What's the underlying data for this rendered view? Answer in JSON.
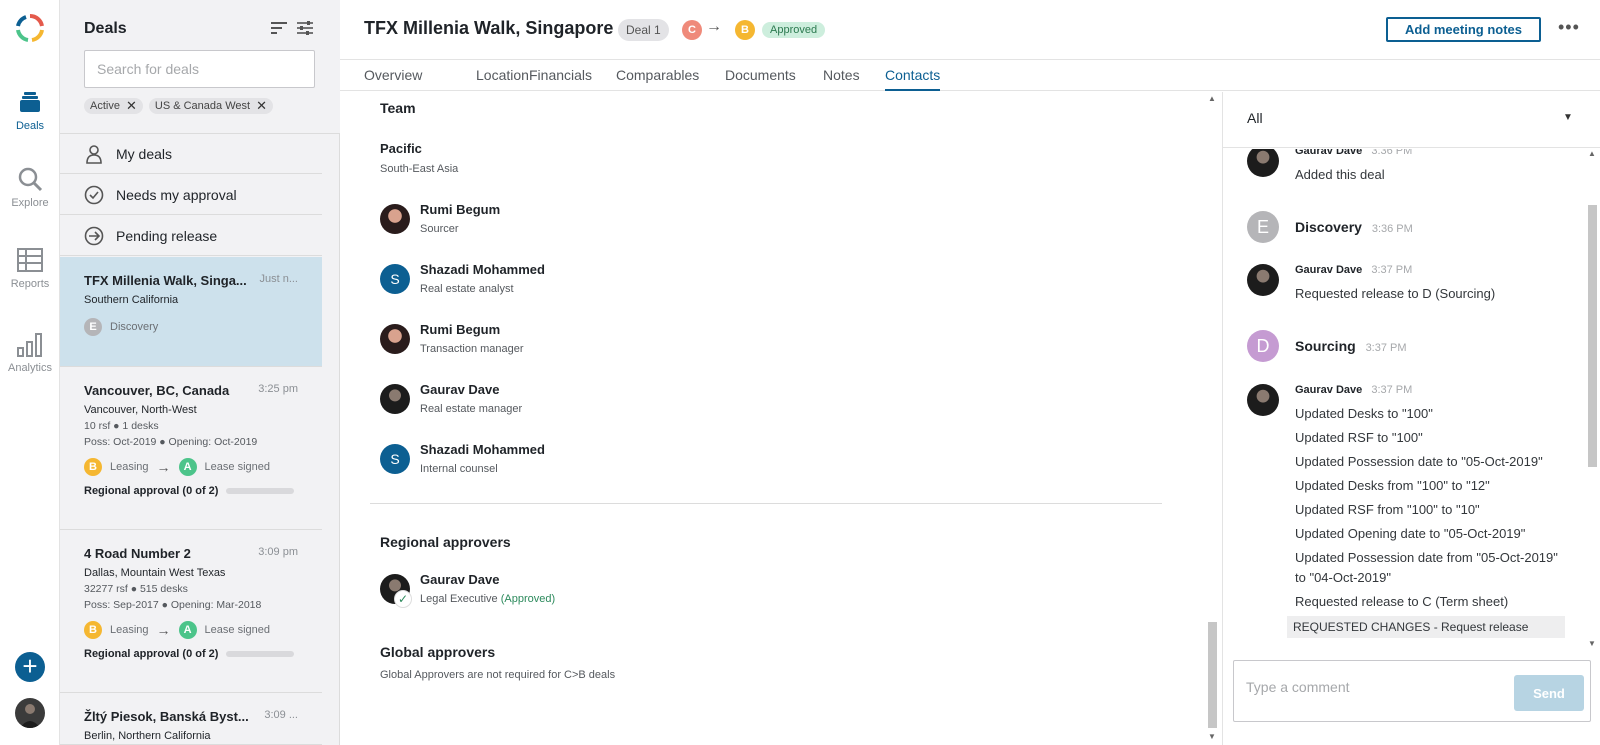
{
  "nav": {
    "deals_label": "Deals",
    "explore_label": "Explore",
    "reports_label": "Reports",
    "analytics_label": "Analytics",
    "add_glyph": "+"
  },
  "deals_panel": {
    "title": "Deals",
    "search_placeholder": "Search for deals",
    "filters": [
      "Active",
      "US & Canada West"
    ],
    "quick_filters": [
      "My deals",
      "Needs my approval",
      "Pending release"
    ],
    "cards": [
      {
        "title": "TFX Millenia Walk, Singa...",
        "time": "Just n...",
        "location": "Southern California",
        "stage_letter": "E",
        "stage": "Discovery"
      },
      {
        "title": "Vancouver, BC, Canada",
        "time": "3:25 pm",
        "location": "Vancouver, North-West",
        "size": "10 rsf ● 1 desks",
        "dates": "Poss: Oct-2019 ● Opening: Oct-2019",
        "from_letter": "B",
        "from_stage": "Leasing",
        "to_letter": "A",
        "to_stage": "Lease signed",
        "approval": "Regional approval (0 of 2)"
      },
      {
        "title": "4 Road Number 2",
        "time": "3:09 pm",
        "location": "Dallas, Mountain West Texas",
        "size": "32277 rsf ● 515 desks",
        "dates": "Poss: Sep-2017 ● Opening: Mar-2018",
        "from_letter": "B",
        "from_stage": "Leasing",
        "to_letter": "A",
        "to_stage": "Lease signed",
        "approval": "Regional approval (0 of 2)"
      },
      {
        "title": "Žltý Piesok, Banská Byst...",
        "time": "3:09 ...",
        "location": "Berlin, Northern California"
      }
    ]
  },
  "header": {
    "title": "TFX Millenia Walk, Singapore",
    "deal_pill": "Deal 1",
    "from_stage_letter": "C",
    "to_stage_letter": "B",
    "status": "Approved",
    "meeting_button": "Add meeting notes",
    "more": "•••"
  },
  "tabs": [
    "Overview",
    "Location",
    "Financials",
    "Comparables",
    "Documents",
    "Notes",
    "Contacts"
  ],
  "contacts": {
    "team_heading": "Team",
    "group_name": "Pacific",
    "group_region": "South-East Asia",
    "people": [
      {
        "name": "Rumi Begum",
        "role": "Sourcer",
        "initial": ""
      },
      {
        "name": "Shazadi Mohammed",
        "role": "Real estate analyst",
        "initial": "S"
      },
      {
        "name": "Rumi Begum",
        "role": "Transaction manager",
        "initial": ""
      },
      {
        "name": "Gaurav Dave",
        "role": "Real estate manager",
        "initial": ""
      },
      {
        "name": "Shazadi Mohammed",
        "role": "Internal counsel",
        "initial": "S"
      }
    ],
    "regional_heading": "Regional approvers",
    "regional_name": "Gaurav Dave",
    "regional_role": "Legal Executive",
    "regional_status": "(Approved)",
    "global_heading": "Global approvers",
    "global_note": "Global Approvers are not required for C>B deals"
  },
  "activity": {
    "filter_value": "All",
    "entries": [
      {
        "kind": "user",
        "who": "Gaurav Dave",
        "time": "3:36 PM",
        "lines": [
          "Added this deal"
        ]
      },
      {
        "kind": "stage",
        "letter": "E",
        "name": "Discovery",
        "time": "3:36 PM"
      },
      {
        "kind": "user",
        "who": "Gaurav Dave",
        "time": "3:37 PM",
        "lines": [
          "Requested release to D (Sourcing)"
        ]
      },
      {
        "kind": "stage",
        "letter": "D",
        "name": "Sourcing",
        "time": "3:37 PM"
      },
      {
        "kind": "user",
        "who": "Gaurav Dave",
        "time": "3:37 PM",
        "lines": [
          "Updated Desks to \"100\"",
          "Updated RSF to \"100\"",
          "Updated Possession date to \"05-Oct-2019\"",
          "Updated Desks from \"100\" to \"12\"",
          "Updated RSF from \"100\" to \"10\"",
          "Updated Opening date to \"05-Oct-2019\"",
          "Updated Possession date from \"05-Oct-2019\" to \"04-Oct-2019\"",
          "Requested release to C (Term sheet)"
        ],
        "note": "REQUESTED CHANGES - Request release"
      }
    ],
    "comment_placeholder": "Type a comment",
    "send_label": "Send"
  },
  "colors": {
    "brand": "#0c5f92",
    "stage_C": "#ef8a7a",
    "stage_B": "#f5b731",
    "stage_A": "#4cc48a",
    "stage_E": "#b5b5b8",
    "stage_D": "#c59bd2",
    "selected_card": "#cde1ec"
  }
}
